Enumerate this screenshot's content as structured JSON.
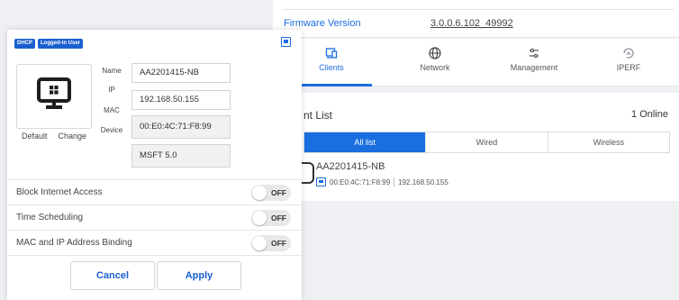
{
  "firmware": {
    "label": "Firmware Version",
    "value": "3.0.0.6.102_49992"
  },
  "tabs": [
    {
      "label": "Clients",
      "icon": "devices-icon",
      "active": true
    },
    {
      "label": "Network",
      "icon": "globe-icon",
      "active": false
    },
    {
      "label": "Management",
      "icon": "sliders-icon",
      "active": false
    },
    {
      "label": "IPERF",
      "icon": "iperf-icon",
      "active": false
    }
  ],
  "client_list": {
    "title": "nt List",
    "online_count": "1",
    "online_label": "Online",
    "filters": [
      "All list",
      "Wired",
      "Wireless"
    ],
    "active_filter": "All list",
    "client": {
      "name": "AA2201415-NB",
      "mac": "00:E0:4C:71:F8:99",
      "ip": "192.168.50.155",
      "os_icon": "windows-icon"
    }
  },
  "panel": {
    "badges": [
      "DHCP",
      "Logged-in User"
    ],
    "os_icon": "windows-icon",
    "device_icon": "windows-monitor-icon",
    "caption_default": "Default",
    "caption_change": "Change",
    "fields": {
      "name_label": "Name",
      "name_value": "AA2201415-NB",
      "ip_label": "IP",
      "ip_value": "192.168.50.155",
      "mac_label": "MAC",
      "mac_value": "00:E0:4C:71:F8:99",
      "device_label": "Device",
      "device_value": "MSFT 5.0"
    },
    "options": [
      {
        "label": "Block Internet Access",
        "state": "OFF"
      },
      {
        "label": "Time Scheduling",
        "state": "OFF"
      },
      {
        "label": "MAC and IP Address Binding",
        "state": "OFF"
      }
    ],
    "cancel_label": "Cancel",
    "apply_label": "Apply"
  },
  "colors": {
    "accent": "#1a6ee0",
    "badge": "#1a5fd0",
    "page_bg": "#eef0f4"
  }
}
